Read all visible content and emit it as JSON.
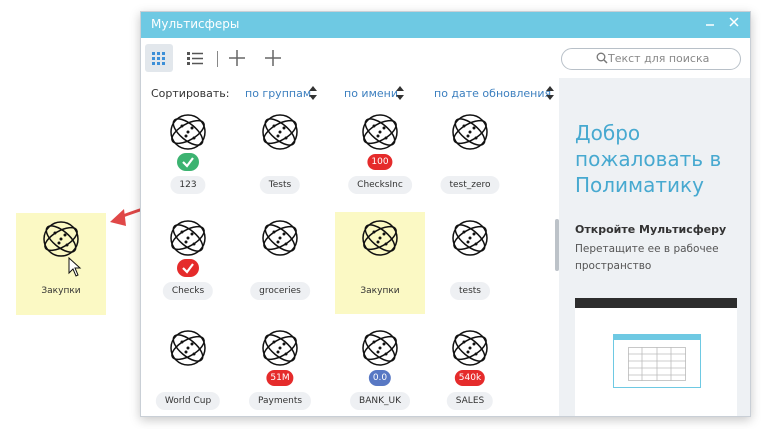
{
  "window": {
    "title": "Мультисферы",
    "minimize_icon": "minimize-icon",
    "close_icon": "close-icon"
  },
  "toolbar": {
    "icons": [
      "grid-view-icon",
      "list-view-icon",
      "plus-icon",
      "plus-icon"
    ],
    "search_placeholder": "Текст для поиска"
  },
  "sort": {
    "label": "Сортировать:",
    "options": [
      "по группам",
      "по имени",
      "по дате обновления"
    ]
  },
  "cubes": [
    {
      "name": "123",
      "badge": "check",
      "badge_color": "#3cb371"
    },
    {
      "name": "Tests",
      "badge": ""
    },
    {
      "name": "ChecksInc",
      "badge": "100",
      "badge_color": "#e52b2b"
    },
    {
      "name": "test_zero",
      "badge": ""
    },
    {
      "name": "Checks",
      "badge": "check",
      "badge_color": "#e52b2b"
    },
    {
      "name": "groceries",
      "badge": ""
    },
    {
      "name": "Закупки",
      "badge": "",
      "selected": true
    },
    {
      "name": "tests",
      "badge": ""
    },
    {
      "name": "World Cup",
      "badge": ""
    },
    {
      "name": "Payments",
      "badge": "51M",
      "badge_color": "#e52b2b"
    },
    {
      "name": "BANK_UK",
      "badge": "0.0",
      "badge_color": "#5878c4"
    },
    {
      "name": "SALES",
      "badge": "540k",
      "badge_color": "#e52b2b"
    }
  ],
  "panel": {
    "welcome": "Добро пожаловать в Полиматику",
    "heading": "Откройте Мультисферу",
    "text": "Перетащите ее в рабочее пространство"
  },
  "dragged": {
    "name": "Закупки"
  },
  "colors": {
    "titlebar": "#6ec9e3",
    "accent": "#47a9d0",
    "selected": "#fbf9c4",
    "arrow": "#e04848"
  }
}
